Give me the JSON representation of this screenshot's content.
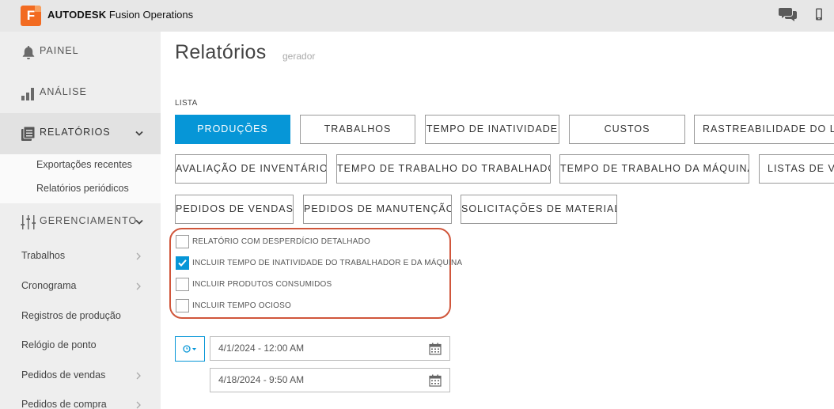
{
  "app": {
    "brand_bold": "AUTODESK",
    "brand_rest": " Fusion Operations",
    "logo_letter": "F"
  },
  "sidebar": {
    "main": [
      {
        "label": "PAINEL",
        "icon": "bell-icon"
      },
      {
        "label": "ANÁLISE",
        "icon": "bar-chart-icon"
      },
      {
        "label": "RELATÓRIOS",
        "icon": "document-icon"
      },
      {
        "label": "GERENCIAMENTO",
        "icon": "sliders-icon"
      }
    ],
    "reports_sub": [
      "Exportações recentes",
      "Relatórios periódicos"
    ],
    "management_items": [
      {
        "label": "Trabalhos",
        "has_arrow": true
      },
      {
        "label": "Cronograma",
        "has_arrow": true
      },
      {
        "label": "Registros de produção",
        "has_arrow": false
      },
      {
        "label": "Relógio de ponto",
        "has_arrow": false
      },
      {
        "label": "Pedidos de vendas",
        "has_arrow": true
      },
      {
        "label": "Pedidos de compra",
        "has_arrow": true
      }
    ]
  },
  "page": {
    "title": "Relatórios",
    "subtitle": "gerador",
    "list_label": "LISTA"
  },
  "report_buttons": {
    "row1": [
      "PRODUÇÕES",
      "TRABALHOS",
      "TEMPO DE INATIVIDADE",
      "CUSTOS",
      "RASTREABILIDADE DO LOTE"
    ],
    "row2": [
      "AVALIAÇÃO DE INVENTÁRIO",
      "TEMPO DE TRABALHO DO TRABALHADOR",
      "TEMPO DE TRABALHO DA MÁQUINA",
      "LISTAS DE VENDAS"
    ],
    "row3": [
      "PEDIDOS DE VENDAS",
      "PEDIDOS DE MANUTENÇÃO",
      "SOLICITAÇÕES DE MATERIAL"
    ],
    "active": "PRODUÇÕES"
  },
  "options": [
    {
      "label": "RELATÓRIO COM DESPERDÍCIO DETALHADO",
      "checked": false
    },
    {
      "label": "INCLUIR TEMPO DE INATIVIDADE DO TRABALHADOR E DA MÁQUINA",
      "checked": true
    },
    {
      "label": "INCLUIR PRODUTOS CONSUMIDOS",
      "checked": false
    },
    {
      "label": "INCLUIR TEMPO OCIOSO",
      "checked": false
    }
  ],
  "date_range": {
    "start": "4/1/2024 - 12:00 AM",
    "end": "4/18/2024 - 9:50 AM"
  },
  "colors": {
    "accent": "#0696d7",
    "highlight_border": "#d0563b",
    "logo": "#f26b21"
  }
}
